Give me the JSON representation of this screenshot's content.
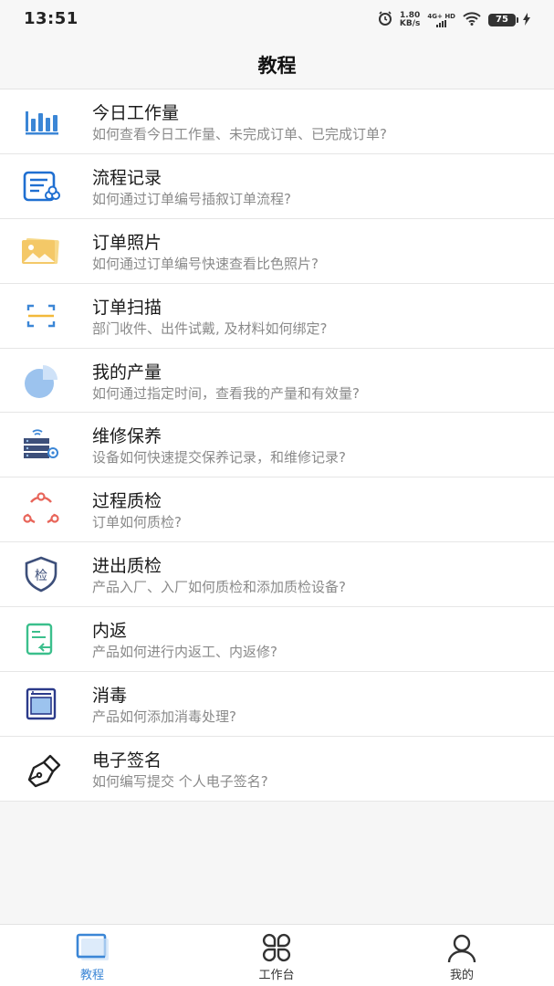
{
  "status_bar": {
    "time": "13:51",
    "net_speed_value": "1.80",
    "net_speed_unit": "KB/s",
    "network_type": "4G+ HD",
    "battery_level": "75"
  },
  "header": {
    "title": "教程"
  },
  "tutorials": [
    {
      "title": "今日工作量",
      "desc": "如何查看今日工作量、未完成订单、已完成订单?",
      "icon": "bar-chart-icon"
    },
    {
      "title": "流程记录",
      "desc": "如何通过订单编号插叙订单流程?",
      "icon": "process-record-icon"
    },
    {
      "title": "订单照片",
      "desc": "如何通过订单编号快速查看比色照片?",
      "icon": "photo-icon"
    },
    {
      "title": "订单扫描",
      "desc": "部门收件、出件试戴, 及材料如何绑定?",
      "icon": "scan-icon"
    },
    {
      "title": "我的产量",
      "desc": "如何通过指定时间，查看我的产量和有效量?",
      "icon": "pie-chart-icon"
    },
    {
      "title": "维修保养",
      "desc": "设备如何快速提交保养记录，和维修记录?",
      "icon": "server-maintenance-icon"
    },
    {
      "title": "过程质检",
      "desc": "订单如何质检?",
      "icon": "cycle-icon"
    },
    {
      "title": "进出质检",
      "desc": "产品入厂、入厂如何质检和添加质检设备?",
      "icon": "shield-check-icon",
      "icon_glyph": "检"
    },
    {
      "title": "内返",
      "desc": "产品如何进行内返工、内返修?",
      "icon": "document-return-icon"
    },
    {
      "title": "消毒",
      "desc": "产品如何添加消毒处理?",
      "icon": "sterilizer-icon"
    },
    {
      "title": "电子签名",
      "desc": "如何编写提交 个人电子签名?",
      "icon": "signature-pen-icon"
    }
  ],
  "tab_bar": {
    "tabs": [
      {
        "label": "教程",
        "icon": "tutorial-book-icon",
        "active": true
      },
      {
        "label": "工作台",
        "icon": "workbench-grid-icon",
        "active": false
      },
      {
        "label": "我的",
        "icon": "profile-icon",
        "active": false
      }
    ],
    "active_color": "#3b86d6"
  },
  "colors": {
    "primary_blue": "#3b86d6",
    "photo_yellow": "#f4c867",
    "scan_orange": "#f2b93b",
    "cycle_red": "#e8655a",
    "return_green": "#3bbf8c",
    "sterilizer_navy": "#2b3a8a"
  }
}
